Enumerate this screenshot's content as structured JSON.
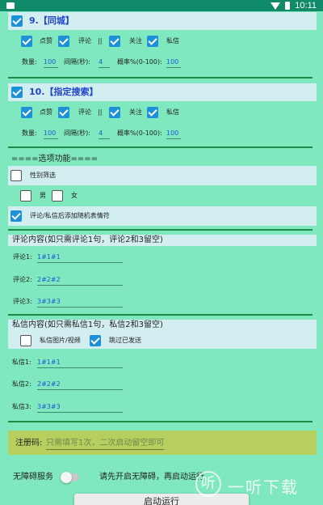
{
  "status_bar": {
    "time": "10:11"
  },
  "task9": {
    "title": "9.【同城】",
    "checked": true,
    "like_label": "点赞",
    "comment_label": "评论",
    "separator": "||",
    "follow_label": "关注",
    "dm_label": "私信",
    "count_label": "数量:",
    "count_value": "100",
    "interval_label": "间隔(秒):",
    "interval_value": "4",
    "prob_label": "概率%(0-100):",
    "prob_value": "100"
  },
  "task10": {
    "title": "10.【指定搜索】",
    "checked": true,
    "like_label": "点赞",
    "comment_label": "评论",
    "separator": "||",
    "follow_label": "关注",
    "dm_label": "私信",
    "count_label": "数量:",
    "count_value": "100",
    "interval_label": "间隔(秒):",
    "interval_value": "4",
    "prob_label": "概率%(0-100):",
    "prob_value": "100"
  },
  "options": {
    "heading": "====选项功能====",
    "gender_filter_label": "性别筛选",
    "male_label": "男",
    "female_label": "女",
    "emoji_label": "评论/私信后添加随机表情符"
  },
  "comments": {
    "heading": "评论内容(如只需评论1句，评论2和3留空)",
    "items": [
      {
        "label": "评论1:",
        "value": "1#1#1"
      },
      {
        "label": "评论2:",
        "value": "2#2#2"
      },
      {
        "label": "评论3:",
        "value": "3#3#3"
      }
    ]
  },
  "messages": {
    "heading": "私信内容(如只需私信1句，私信2和3留空)",
    "image_video_label": "私信图片/视频",
    "skip_sent_label": "跳过已发送",
    "items": [
      {
        "label": "私信1:",
        "value": "1#1#1"
      },
      {
        "label": "私信2:",
        "value": "2#2#2"
      },
      {
        "label": "私信3:",
        "value": "3#3#3"
      }
    ]
  },
  "register": {
    "label": "注册码:",
    "placeholder": "只需填写1次，二次启动留空即可"
  },
  "accessibility": {
    "label": "无障碍服务",
    "hint": "请先开启无障碍，再启动运行"
  },
  "run_button": "启动运行",
  "watermark": {
    "logo_glyph": "听",
    "text": "一听下载"
  },
  "colors": {
    "background": "#7fe8be",
    "checkbox": "#1e90d8",
    "divider": "#1d8a4a",
    "title": "#2244c8",
    "value": "#1a5ad8"
  }
}
